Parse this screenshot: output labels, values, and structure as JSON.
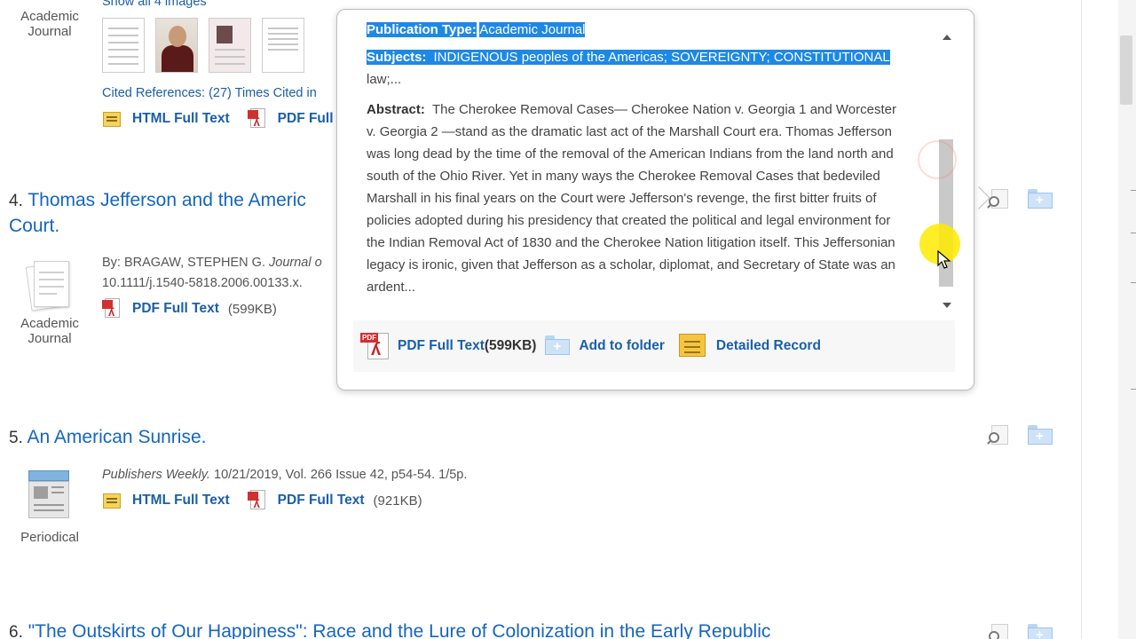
{
  "result3": {
    "pub_type_line1": "Academic",
    "pub_type_line2": "Journal",
    "show_images": "Show all 4 images",
    "cited": "Cited References: (27) Times Cited in",
    "html_full_text": "HTML Full Text",
    "pdf_full_text": "PDF Full"
  },
  "result4": {
    "number": "4.",
    "title_line1": "Thomas Jefferson and the Americ",
    "title_line2": "Court.",
    "byline_prefix": "By: BRAGAW, STEPHEN G.",
    "byline_journal": "Journal o",
    "doi": "10.1111/j.1540-5818.2006.00133.x.",
    "pdf_full_text": "PDF Full Text",
    "pdf_size": "(599KB)",
    "pub_type_line1": "Academic",
    "pub_type_line2": "Journal"
  },
  "result5": {
    "number": "5.",
    "title": "An American Sunrise.",
    "source_italic": "Publishers Weekly.",
    "source_rest": "10/21/2019, Vol. 266 Issue 42, p54-54. 1/5p.",
    "html_full_text": "HTML Full Text",
    "pdf_full_text": "PDF Full Text",
    "pdf_size": "(921KB)",
    "pub_type": "Periodical"
  },
  "result6": {
    "number": "6.",
    "title": "\"The Outskirts of Our Happiness\": Race and the Lure of Colonization in the Early Republic"
  },
  "popup": {
    "pub_type_label": "Publication Type:",
    "pub_type_value": "Academic Journal",
    "subjects_label": "Subjects:",
    "subjects_value": "INDIGENOUS peoples of the Americas; SOVEREIGNTY; CONSTITUTIONAL",
    "subjects_cont": "law;...",
    "abstract_label": "Abstract:",
    "abstract_lines": [
      "The Cherokee Removal Cases— Cherokee Nation v. Georgia 1 and Worcester",
      "v. Georgia 2 —stand as the dramatic last act of the Marshall Court era. Thomas Jefferson",
      "was long dead by the time of the removal of the American Indians from the land north and",
      "south of the Ohio River. Yet in many ways the Cherokee Removal Cases that bedeviled",
      "Marshall in his final years on the Court were Jefferson's revenge, the first bitter fruits of",
      "policies adopted during his presidency that created the political and legal environment for",
      "the Indian Removal Act of 1830 and the Cherokee Nation litigation itself. This Jeffersonian",
      "legacy is ironic, given that Jefferson as a scholar, diplomat, and Secretary of State was an",
      "ardent..."
    ],
    "pdf_full_text": "PDF Full Text",
    "pdf_size": "(599KB)",
    "add_to_folder": "Add to folder",
    "detailed_record": "Detailed Record"
  }
}
